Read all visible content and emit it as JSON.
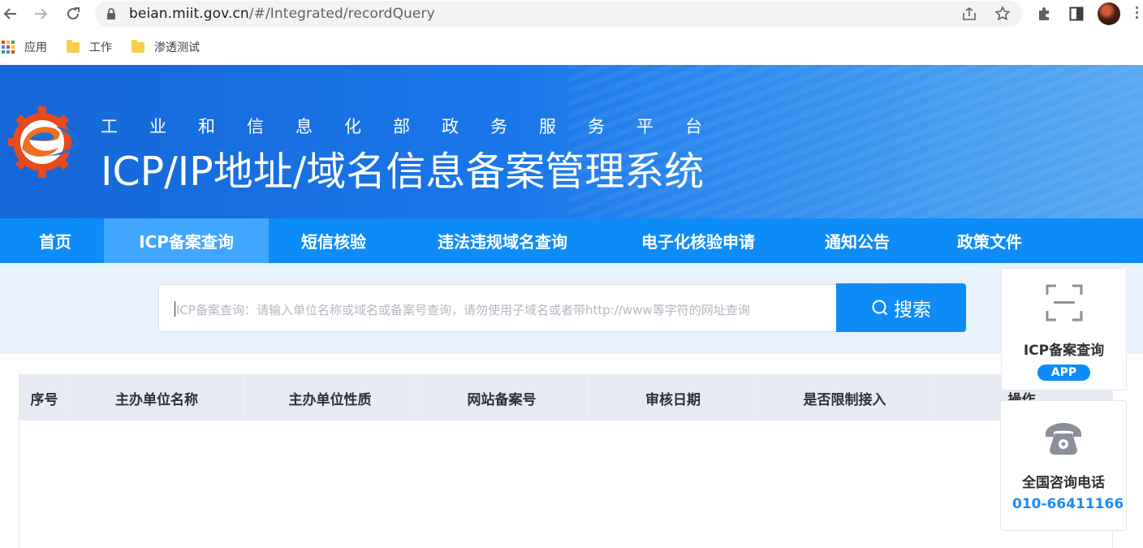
{
  "browser": {
    "url_host": "beian.miit.gov.cn",
    "url_rest": "/#/Integrated/recordQuery",
    "bookmarks": [
      {
        "label": "应用",
        "icon": "apps-grid-icon"
      },
      {
        "label": "工作",
        "icon": "folder-icon"
      },
      {
        "label": "渗透测试",
        "icon": "folder-icon"
      }
    ]
  },
  "banner": {
    "subtitle": "工业和信息化部政务服务平台",
    "title": "ICP/IP地址/域名信息备案管理系统",
    "logo_colors": {
      "gear": "#e8491d",
      "swirl": "#f06f1f",
      "blue": "#1d6fd8"
    }
  },
  "nav": {
    "items": [
      {
        "label": "首页"
      },
      {
        "label": "ICP备案查询",
        "active": true
      },
      {
        "label": "短信核验"
      },
      {
        "label": "违法违规域名查询"
      },
      {
        "label": "电子化核验申请"
      },
      {
        "label": "通知公告"
      },
      {
        "label": "政策文件"
      }
    ]
  },
  "search": {
    "placeholder": "ICP备案查询：请输入单位名称或域名或备案号查询，请勿使用子域名或者带http://www等字符的网址查询",
    "button_label": "搜索"
  },
  "table": {
    "headers": [
      "序号",
      "主办单位名称",
      "主办单位性质",
      "网站备案号",
      "审核日期",
      "是否限制接入",
      "操作"
    ]
  },
  "side": {
    "app_title": "ICP备案查询",
    "app_badge": "APP",
    "phone_title": "全国咨询电话",
    "phone_number": "010-66411166"
  },
  "colors": {
    "primary": "#0d8cf7",
    "nav_active": "#3fa7ff",
    "search_bg": "#e7f2fd",
    "table_header_bg": "#e6eaf2"
  }
}
